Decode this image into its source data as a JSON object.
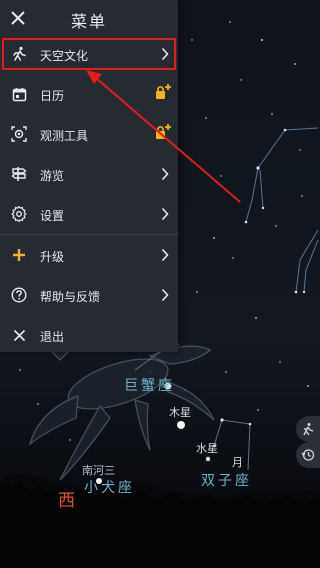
{
  "menu": {
    "title": "菜单",
    "items": [
      {
        "label": "天空文化",
        "icon": "running-figure-icon",
        "trailing": "chevron",
        "highlighted": true
      },
      {
        "label": "日历",
        "icon": "calendar-icon",
        "trailing": "lock"
      },
      {
        "label": "观测工具",
        "icon": "observe-target-icon",
        "trailing": "lock"
      },
      {
        "label": "游览",
        "icon": "signpost-icon",
        "trailing": "chevron"
      },
      {
        "label": "设置",
        "icon": "gear-icon",
        "trailing": "chevron"
      },
      {
        "label": "升级",
        "icon": "plus-icon",
        "trailing": "chevron"
      },
      {
        "label": "帮助与反馈",
        "icon": "help-circle-icon",
        "trailing": "chevron"
      },
      {
        "label": "退出",
        "icon": "close-icon",
        "trailing": "none"
      }
    ]
  },
  "sky": {
    "labels": {
      "jupiter": "木星",
      "mercury": "水星",
      "moon": "月",
      "star_nanhe3": "南河三"
    },
    "constellations": {
      "cancer": "巨蟹座",
      "canis_minor": "小犬座",
      "gemini": "双子座"
    },
    "compass": "西"
  },
  "colors": {
    "menu_bg": "#262a31",
    "highlight_border": "#e21b1b",
    "arrow": "#e21b1b",
    "constellation_text": "#6fb2cc",
    "compass": "#e0523e",
    "upgrade_plus": "#f2b323",
    "lock": "#f2b323"
  },
  "sky_tools": [
    "compass-target-icon",
    "history-icon"
  ]
}
